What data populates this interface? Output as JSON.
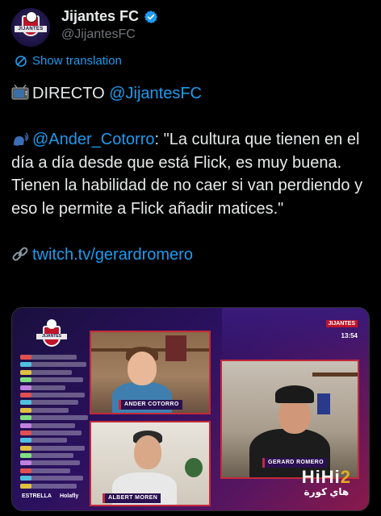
{
  "author": {
    "display_name": "Jijantes FC",
    "handle": "@JijantesFC",
    "avatar_text": "JIJANTES",
    "verified": true
  },
  "translate_label": "Show translation",
  "tweet": {
    "line1_prefix": "DIRECTO ",
    "line1_mention": "@JijantesFC",
    "quote_mention": "@Ander_Cotorro",
    "quote_text": ": \"La cultura que tienen en el día a día desde que está Flick, es muy buena. Tienen la habilidad de no caer si van perdiendo y eso le permite a Flick añadir matices.\"",
    "link": "twitch.tv/gerardromero"
  },
  "media": {
    "brand_badge": "JIJANTES",
    "clock": "13:54",
    "crest_text": "JIJANTES",
    "cams": [
      {
        "name": "ANDER COTORRO"
      },
      {
        "name": "ALBERT MOREN"
      },
      {
        "name": "GERARD ROMERO"
      }
    ],
    "sponsors": [
      "ESTRELLA",
      "Holafly"
    ]
  },
  "watermark": {
    "text_a": "HiHi",
    "text_b": "2",
    "arabic": "هاي كورة"
  },
  "colors": {
    "link": "#1d9bf0",
    "text": "#e7e9ea",
    "muted": "#71767b",
    "frame": "#c42a3a"
  }
}
